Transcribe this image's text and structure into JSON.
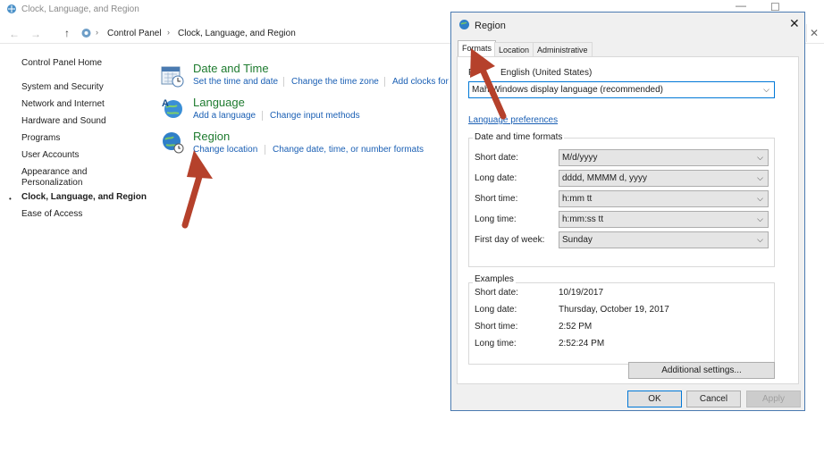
{
  "control_panel": {
    "window_title": "Clock, Language, and Region",
    "breadcrumb": [
      "Control Panel",
      "Clock, Language, and Region"
    ],
    "sidebar": {
      "items": [
        {
          "label": "Control Panel Home"
        },
        {
          "label": "System and Security"
        },
        {
          "label": "Network and Internet"
        },
        {
          "label": "Hardware and Sound"
        },
        {
          "label": "Programs"
        },
        {
          "label": "User Accounts"
        },
        {
          "label": "Appearance and"
        },
        {
          "label": "Personalization"
        },
        {
          "label": "Clock, Language, and Region"
        },
        {
          "label": "Ease of Access"
        }
      ]
    },
    "categories": [
      {
        "title": "Date and Time",
        "icon": "calendar-clock-icon",
        "links": [
          "Set the time and date",
          "Change the time zone",
          "Add clocks for"
        ]
      },
      {
        "title": "Language",
        "icon": "language-globe-icon",
        "links": [
          "Add a language",
          "Change input methods"
        ]
      },
      {
        "title": "Region",
        "icon": "region-globe-icon",
        "links": [
          "Change location",
          "Change date, time, or number formats"
        ]
      }
    ]
  },
  "dialog": {
    "title": "Region",
    "tabs": [
      "Formats",
      "Location",
      "Administrative"
    ],
    "selected_tab": "Formats",
    "format_label_visible": "English (United States)",
    "format_label_prefix": "F",
    "format_combo": {
      "prefix": "Ma",
      "text": "h Windows display language (recommended)"
    },
    "language_preferences_link": "Language preferences",
    "date_time_group": {
      "label": "Date and time formats",
      "rows": [
        {
          "label": "Short date:",
          "value": "M/d/yyyy"
        },
        {
          "label": "Long date:",
          "value": "dddd, MMMM d, yyyy"
        },
        {
          "label": "Short time:",
          "value": "h:mm tt"
        },
        {
          "label": "Long time:",
          "value": "h:mm:ss tt"
        },
        {
          "label": "First day of week:",
          "value": "Sunday"
        }
      ]
    },
    "examples_group": {
      "label": "Examples",
      "rows": [
        {
          "label": "Short date:",
          "value": "10/19/2017"
        },
        {
          "label": "Long date:",
          "value": "Thursday, October 19, 2017"
        },
        {
          "label": "Short time:",
          "value": "2:52 PM"
        },
        {
          "label": "Long time:",
          "value": "2:52:24 PM"
        }
      ]
    },
    "additional_settings_label": "Additional settings...",
    "buttons": {
      "ok": "OK",
      "cancel": "Cancel",
      "apply": "Apply"
    },
    "close_glyph": "✕"
  },
  "colors": {
    "link": "#1a5fb4",
    "category_title": "#1e7b2f",
    "annotation_arrow": "#b5412b"
  }
}
